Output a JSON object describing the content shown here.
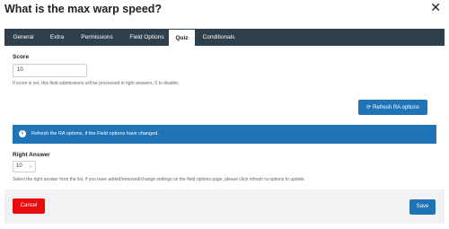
{
  "modal": {
    "title": "What is the max warp speed?",
    "close": "✕"
  },
  "tabs": [
    {
      "label": "General"
    },
    {
      "label": "Extra"
    },
    {
      "label": "Permissions"
    },
    {
      "label": "Field Options"
    },
    {
      "label": "Quiz"
    },
    {
      "label": "Conditionals"
    }
  ],
  "active_tab": "Quiz",
  "score": {
    "label": "Score",
    "value": "10",
    "help": "If score is set, this field submissions will be processed in right answers, 0 to disable."
  },
  "refresh_button": {
    "icon": "refresh-icon",
    "label": "Refresh RA options"
  },
  "notice": {
    "icon": "info-icon",
    "text": "Refresh the RA options, if the Field options have changed."
  },
  "right_answer": {
    "label": "Right Answer",
    "selected": "10",
    "help": "Select the right answer from the list, if you have added/removed/change settings on the field options page, please click refresh ra options to update."
  },
  "footer": {
    "cancel_label": "Cancel",
    "save_label": "Save"
  },
  "colors": {
    "tabbar": "#2f3f4c",
    "primary": "#1f74b7",
    "danger": "#e60d0d",
    "footer_bg": "#f2f2f4"
  }
}
